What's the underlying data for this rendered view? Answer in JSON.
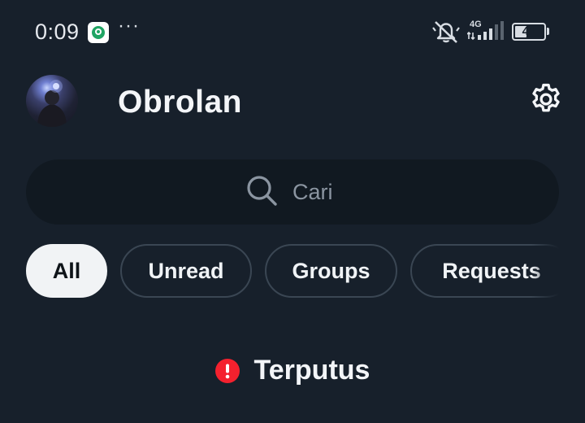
{
  "status_bar": {
    "time": "0:09",
    "notification_app_icon": "maps-pin-icon",
    "overflow": "···",
    "network_type": "4G",
    "battery_level": "41",
    "battery_fraction": 0.41,
    "icons": [
      "bell-muted-icon",
      "signal-icon",
      "battery-icon"
    ]
  },
  "header": {
    "title": "Obrolan",
    "avatar_icon": "avatar",
    "settings_icon": "gear-icon"
  },
  "search": {
    "placeholder": "Cari",
    "icon": "search-icon"
  },
  "filters": {
    "chips": [
      {
        "label": "All",
        "active": true
      },
      {
        "label": "Unread",
        "active": false
      },
      {
        "label": "Groups",
        "active": false
      },
      {
        "label": "Requests",
        "active": false
      }
    ]
  },
  "connection": {
    "status_text": "Terputus",
    "icon": "alert-circle-icon",
    "alert_color": "#f4212e"
  },
  "colors": {
    "background": "#17202b",
    "search_background": "#111921",
    "chip_border": "#3a4653",
    "chip_active_background": "#f1f3f5"
  }
}
